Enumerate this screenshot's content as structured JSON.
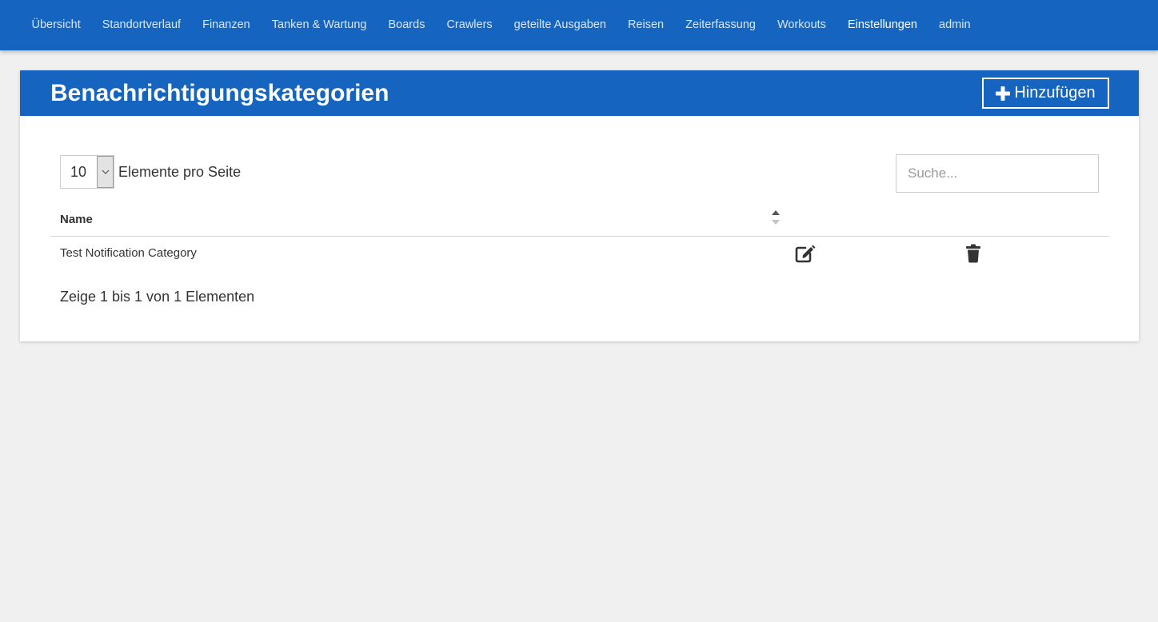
{
  "nav": {
    "items": [
      {
        "label": "Übersicht"
      },
      {
        "label": "Standortverlauf"
      },
      {
        "label": "Finanzen"
      },
      {
        "label": "Tanken & Wartung"
      },
      {
        "label": "Boards"
      },
      {
        "label": "Crawlers"
      },
      {
        "label": "geteilte Ausgaben"
      },
      {
        "label": "Reisen"
      },
      {
        "label": "Zeiterfassung"
      },
      {
        "label": "Workouts"
      },
      {
        "label": "Einstellungen",
        "active": true
      },
      {
        "label": "admin"
      }
    ]
  },
  "page": {
    "title": "Benachrichtigungskategorien",
    "add_label": "Hinzufügen",
    "add_icon": "plus-icon"
  },
  "table_controls": {
    "page_length": "10",
    "page_length_label": "Elemente pro Seite",
    "search_placeholder": "Suche...",
    "search_value": ""
  },
  "table": {
    "columns": [
      {
        "label": "Name",
        "sort": "ascending"
      }
    ],
    "rows": [
      {
        "name": "Test Notification Category",
        "actions": [
          "edit-icon",
          "trash-icon"
        ]
      }
    ],
    "info": "Zeige 1 bis 1 von 1 Elementen"
  },
  "colors": {
    "primary": "#1565c0",
    "background": "#f0f0f0",
    "nav_text": "#dbe6f6",
    "nav_active": "#ffffff",
    "text": "#333333"
  }
}
